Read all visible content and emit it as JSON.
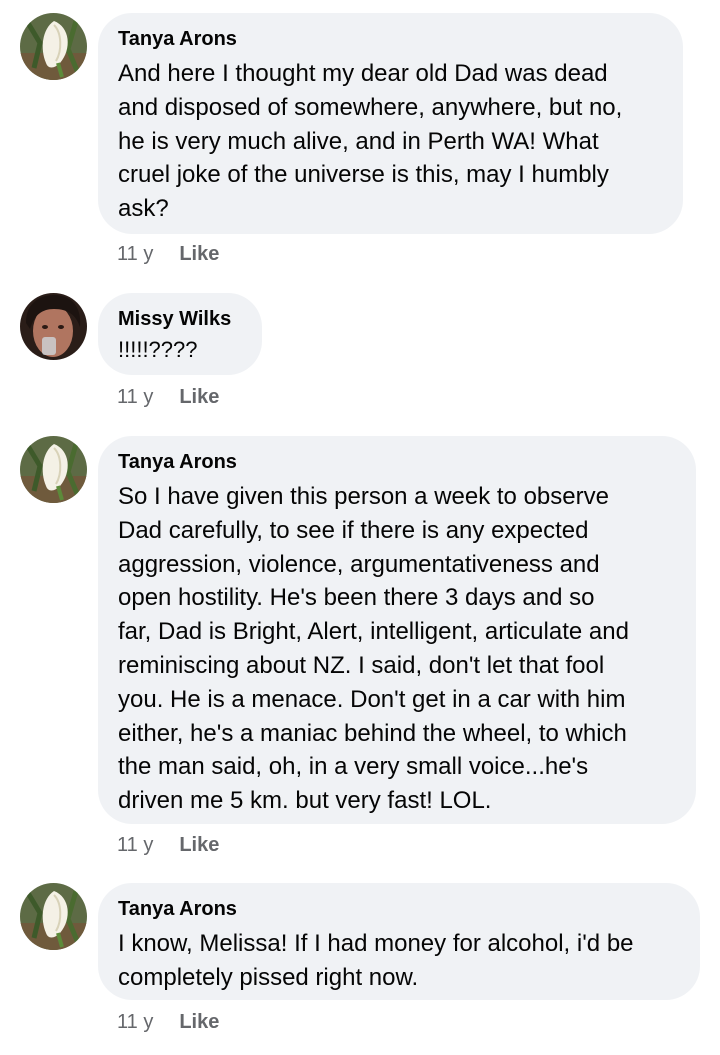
{
  "comments": [
    {
      "author": "Tanya Arons",
      "text": "And here I thought my dear old Dad was dead\nand disposed of somewhere, anywhere, but no,\nhe is very much alive, and in Perth WA!  What\ncruel joke of the universe is this, may I humbly\nask?",
      "time": "11 y",
      "like_label": "Like",
      "avatar_icon": "calla-lily-avatar"
    },
    {
      "author": "Missy Wilks",
      "text": "!!!!!????",
      "time": "11 y",
      "like_label": "Like",
      "avatar_icon": "woman-photo-avatar"
    },
    {
      "author": "Tanya Arons",
      "text": "So I have given this person a week to observe\nDad carefully, to see if there is any expected\naggression, violence, argumentativeness and\nopen hostility.  He's been there 3 days and so\nfar, Dad is Bright, Alert, intelligent, articulate and\nreminiscing about NZ.  I said, don't let that fool\nyou. He is a menace.  Don't get in a car with him\neither, he's a maniac behind the wheel, to which\nthe man said, oh, in a very small voice...he's\ndriven me 5 km.  but very fast!  LOL.",
      "time": "11 y",
      "like_label": "Like",
      "avatar_icon": "calla-lily-avatar"
    },
    {
      "author": "Tanya Arons",
      "text": "I know, Melissa!  If I had money for alcohol, i'd be\ncompletely pissed right now.",
      "time": "11 y",
      "like_label": "Like",
      "avatar_icon": "calla-lily-avatar"
    }
  ],
  "colors": {
    "bubble_bg": "#f0f2f5",
    "meta_text": "#65676b",
    "body_text": "#050505"
  }
}
